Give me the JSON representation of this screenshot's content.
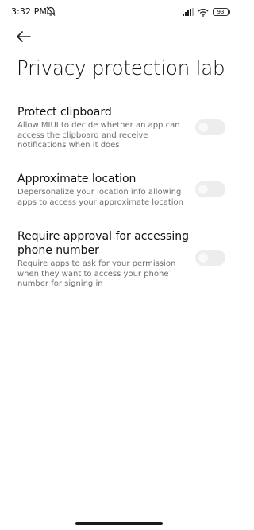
{
  "status_bar": {
    "time": "3:32 PM",
    "battery_level": "93",
    "icons": [
      "alarm-muted-icon",
      "signal-icon",
      "wifi-icon",
      "battery-icon"
    ]
  },
  "header": {
    "back_icon": "back-arrow-icon",
    "title": "Privacy protection lab"
  },
  "settings": [
    {
      "title": "Protect clipboard",
      "description": "Allow MIUI to decide whether an app can access the clipboard and receive notifications when it does",
      "enabled": false
    },
    {
      "title": "Approximate location",
      "description": "Depersonalize your location info allowing apps to access your approximate location",
      "enabled": false
    },
    {
      "title": "Require approval for accessing phone number",
      "description": "Require apps to ask for your permission when they want to access your phone number for signing in",
      "enabled": false
    }
  ],
  "colors": {
    "background": "#ffffff",
    "title_text": "#111111",
    "description_text": "#6d6d6d",
    "toggle_off_track": "#ededed"
  }
}
